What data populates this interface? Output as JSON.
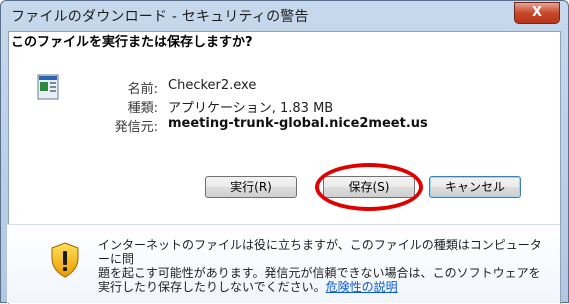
{
  "window": {
    "title": "ファイルのダウンロード - セキュリティの警告",
    "close_label": "X"
  },
  "dialog": {
    "question": "このファイルを実行または保存しますか?",
    "file": {
      "icon": "executable-file-icon",
      "name_label": "名前:",
      "name": "Checker2.exe",
      "type_label": "種類:",
      "type": "アプリケーション, 1.83 MB",
      "from_label": "発信元:",
      "from": "meeting-trunk-global.nice2meet.us"
    },
    "buttons": {
      "run": "実行(R)",
      "save": "保存(S)",
      "cancel": "キャンセル"
    },
    "warning": {
      "icon": "security-shield-icon",
      "line1": "インターネットのファイルは役に立ちますが、このファイルの種類はコンピューターに問",
      "line2": "題を起こす可能性があります。発信元が信頼できない場合は、このソフトウェアを",
      "line3": "実行したり保存したりしないでください。",
      "link": "危険性の説明"
    }
  },
  "annotation": {
    "color": "#e00000",
    "target": "save-button"
  }
}
